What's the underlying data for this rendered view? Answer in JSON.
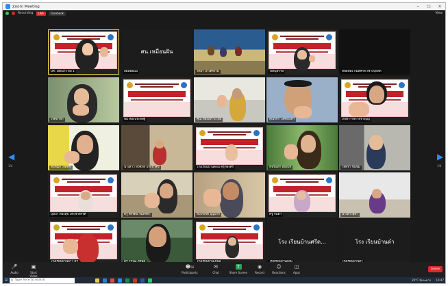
{
  "window": {
    "title": "Zoom Meeting",
    "minimize": "–",
    "maximize": "□",
    "close": "×"
  },
  "meeting_bar": {
    "recording": "Recording",
    "live_badge": "LIVE",
    "stream": "Facebook",
    "view_toggle": "View"
  },
  "gallery": {
    "page_left": "1/4",
    "page_right": "1/4",
    "tiles": [
      {
        "name": "บค. เสือนาง ลบ 1",
        "center": ""
      },
      {
        "name": "สมสมัยแม",
        "center": "ศน.เหมือนฝัน"
      },
      {
        "name": "วิทยา บางศรีงาม",
        "center": ""
      },
      {
        "name": "ใจสมุยราษ",
        "center": ""
      },
      {
        "name": "ทิพย์ทอง กมลศักดิ์ สร้างบุหลัด",
        "center": ""
      },
      {
        "name": "ใจศิลาฟ้า",
        "center": ""
      },
      {
        "name": "พิม ทองประดิษฐ์",
        "center": ""
      },
      {
        "name": "คุณ ทองเพราะไทย",
        "center": ""
      },
      {
        "name": "คุณจักร วงศ์ทองคำ",
        "center": ""
      },
      {
        "name": "เกษร กำพร้าสร้างบุญ",
        "center": ""
      },
      {
        "name": "สมหญิง วงศ์สุข",
        "center": ""
      },
      {
        "name": "นางสาว ทวีศักดิ์ ประชาสุข",
        "center": ""
      },
      {
        "name": "โรงเรียนบ้านดอน คุรุทองศรี",
        "center": ""
      },
      {
        "name": "พัชรินทร์ ทองแท้",
        "center": ""
      },
      {
        "name": "วิจิตรา ชื่นชม",
        "center": ""
      },
      {
        "name": "บุษบา ทองสุข ประชาสรรค์",
        "center": ""
      },
      {
        "name": "ครู ศิริรัตน์ จันทร์ตา",
        "center": ""
      },
      {
        "name": "สมเกียรติ บุญมาก",
        "center": ""
      },
      {
        "name": "ครู จินดา",
        "center": ""
      },
      {
        "name": "นางสาวสุดา",
        "center": ""
      },
      {
        "name": "โรงเรียนบ้านอ่าว ครู",
        "center": ""
      },
      {
        "name": "ครู วรวุฒิ ครูนัย",
        "center": ""
      },
      {
        "name": "โรงเรียนบ้านเหนือ",
        "center": ""
      },
      {
        "name": "โรงเรียนบ้านดอน",
        "center": "โรง เรียนบ้านศรีด..."
      },
      {
        "name": "โรงเรียนบ้านดำ",
        "center": "โรง เรียนบ้านดำ"
      }
    ]
  },
  "controls": {
    "audio": "Audio",
    "video": "Start Video",
    "participants": "Participants",
    "participant_count": "56",
    "chat": "Chat",
    "share": "Share Screen",
    "record": "Record",
    "reactions": "Reactions",
    "apps": "Apps",
    "leave": "Leave"
  },
  "taskbar": {
    "search_placeholder": "Type here to search",
    "weather": "29°C มีเมฆมาก",
    "clock": "10:47"
  },
  "colors": {
    "zoom_blue": "#2D8CFF",
    "leave_red": "#e02828",
    "slide_red": "#c3222b"
  }
}
